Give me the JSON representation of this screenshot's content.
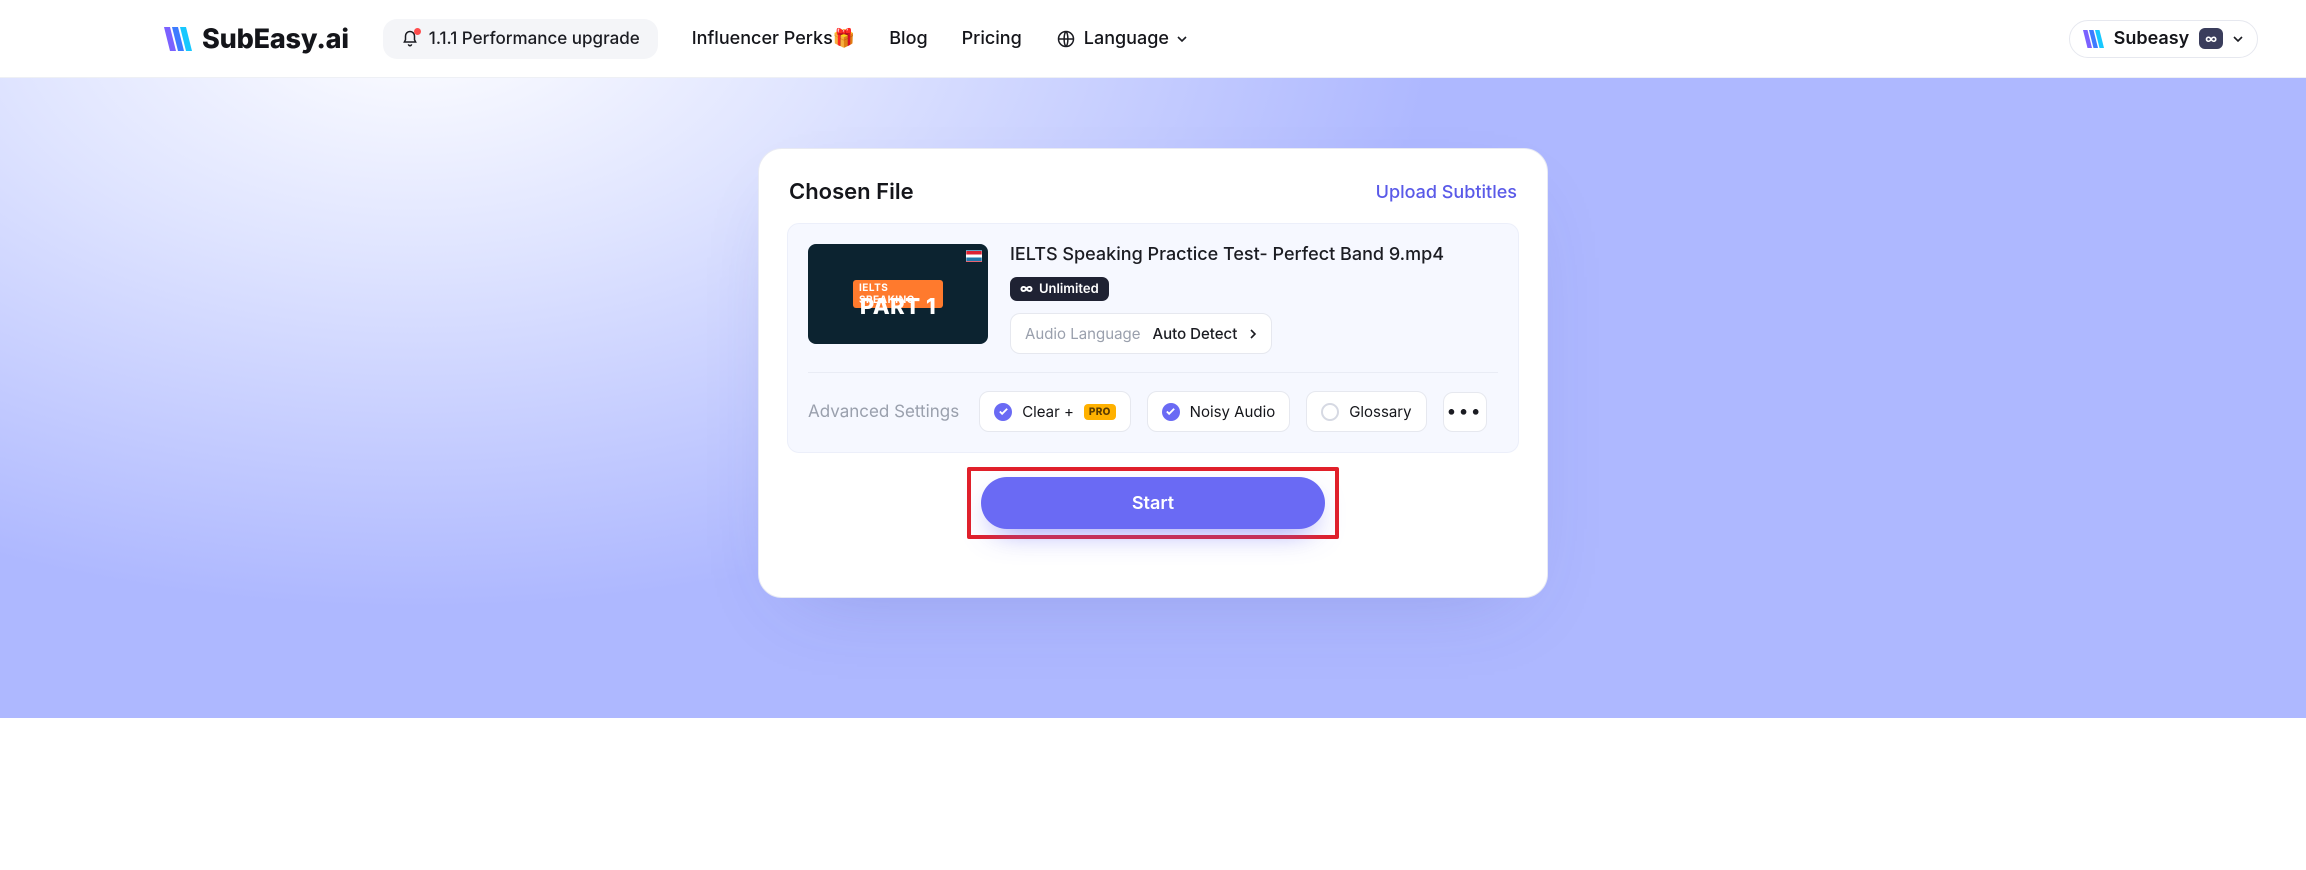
{
  "brand": {
    "name": "SubEasy.ai"
  },
  "nav": {
    "announcement": "1.1.1 Performance upgrade",
    "influencer": "Influencer Perks",
    "blog": "Blog",
    "pricing": "Pricing",
    "language_label": "Language"
  },
  "account": {
    "name": "Subeasy",
    "plan_icon": "∞"
  },
  "panel": {
    "title": "Chosen File",
    "upload_link": "Upload Subtitles",
    "file": {
      "name": "IELTS Speaking Practice Test- Perfect Band 9.mp4",
      "thumb_tag": "IELTS SPEAKING",
      "thumb_big": "PART 1",
      "badge_label": "Unlimited",
      "audio_language_label": "Audio Language",
      "audio_language_value": "Auto Detect"
    },
    "advanced": {
      "label": "Advanced Settings",
      "clear": "Clear +",
      "pro_tag": "PRO",
      "noisy": "Noisy Audio",
      "glossary": "Glossary"
    },
    "start_label": "Start"
  }
}
